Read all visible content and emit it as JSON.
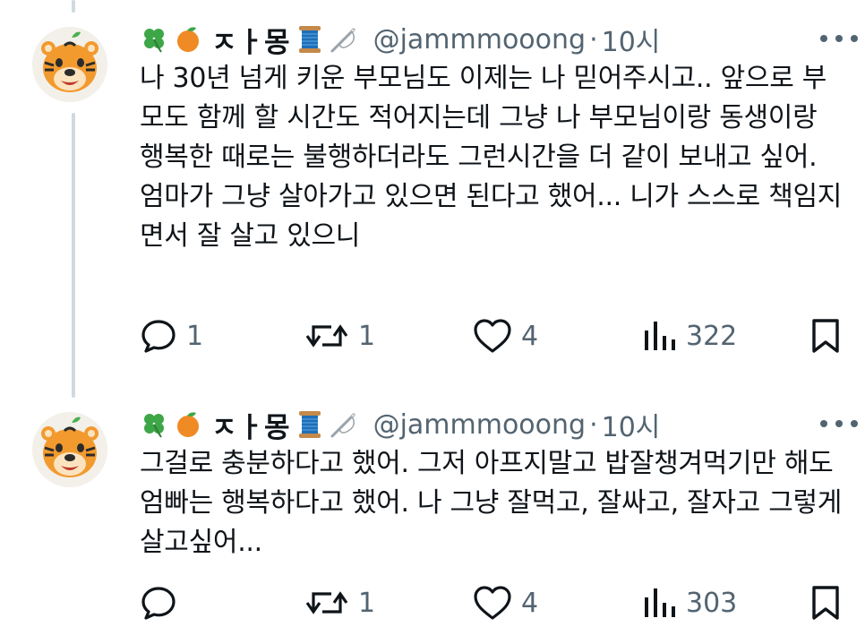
{
  "tweets": [
    {
      "avatar_icon": "tiger-face-icon",
      "emojis": [
        "four-leaf-clover-icon",
        "tangerine-icon"
      ],
      "display_name": "ㅈㅏ몽",
      "trailing_icons": [
        "thread-spool-icon",
        "sewing-needle-icon"
      ],
      "handle": "@jammmooong",
      "separator": "·",
      "time": "10시",
      "paragraphs": [
        "나 30년 넘게 키운 부모님도 이제는 나 믿어주시고.. 앞으로 부모도 함께 할 시간도 적어지는데 그냥 나 부모님이랑 동생이랑 행복한 때로는 불행하더라도 그런시간을 더 같이 보내고 싶어.",
        "엄마가 그냥 살아가고 있으면 된다고 했어... 니가 스스로 책임지면서 잘 살고 있으니"
      ],
      "replies": "1",
      "reposts": "1",
      "likes": "4",
      "views": "322"
    },
    {
      "avatar_icon": "tiger-face-icon",
      "emojis": [
        "four-leaf-clover-icon",
        "tangerine-icon"
      ],
      "display_name": "ㅈㅏ몽",
      "trailing_icons": [
        "thread-spool-icon",
        "sewing-needle-icon"
      ],
      "handle": "@jammmooong",
      "separator": "·",
      "time": "10시",
      "paragraphs": [
        "그걸로 충분하다고 했어. 그저 아프지말고 밥잘챙겨먹기만 해도 엄빠는 행복하다고 했어. 나 그냥 잘먹고, 잘싸고, 잘자고 그렇게 살고싶어..."
      ],
      "replies": "",
      "reposts": "1",
      "likes": "4",
      "views": "303"
    }
  ],
  "colors": {
    "text": "#0f1419",
    "secondary": "#536471",
    "thread_line": "#cfd9de"
  }
}
